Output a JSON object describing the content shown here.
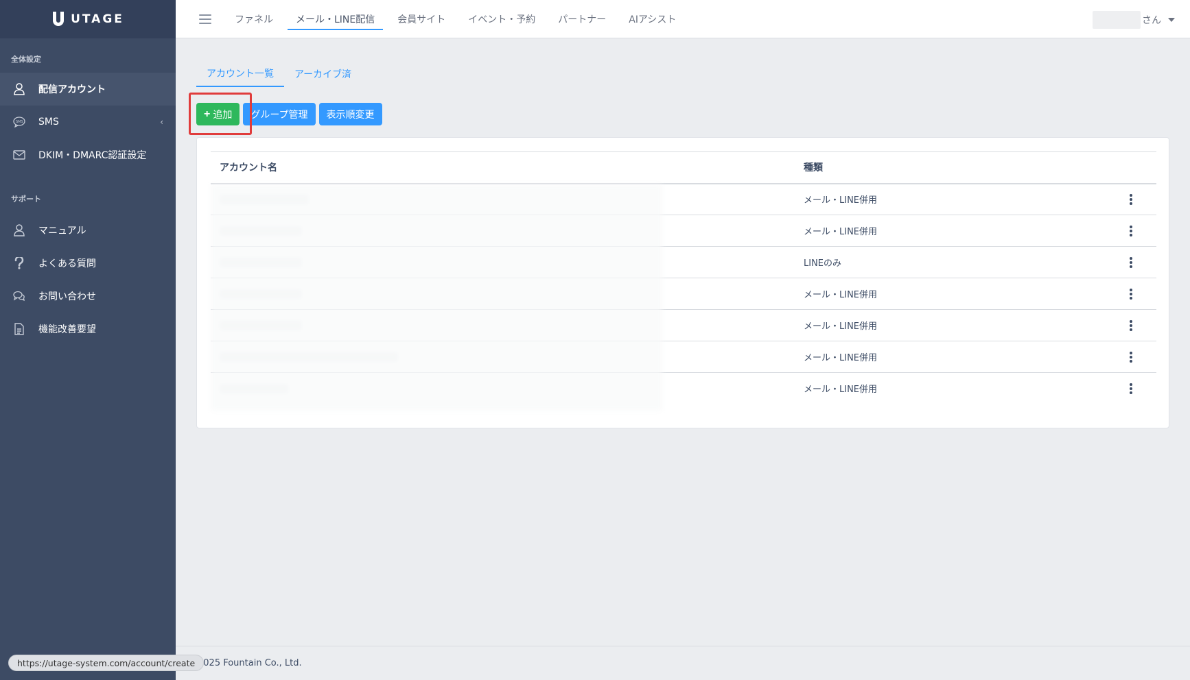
{
  "brand": {
    "name": "UTAGE"
  },
  "sidebar": {
    "section_settings": "全体設定",
    "section_support": "サポート",
    "items": [
      {
        "label": "配信アカウント",
        "icon": "user-icon"
      },
      {
        "label": "SMS",
        "icon": "sms-icon"
      },
      {
        "label": "DKIM・DMARC認証設定",
        "icon": "mail-icon"
      }
    ],
    "support_items": [
      {
        "label": "マニュアル",
        "icon": "user-icon"
      },
      {
        "label": "よくある質問",
        "icon": "question-icon"
      },
      {
        "label": "お問い合わせ",
        "icon": "chat-icon"
      },
      {
        "label": "機能改善要望",
        "icon": "document-icon"
      }
    ],
    "sms_caret": "‹"
  },
  "header": {
    "nav": [
      "ファネル",
      "メール・LINE配信",
      "会員サイト",
      "イベント・予約",
      "パートナー",
      "AIアシスト"
    ],
    "user_suffix": "さん"
  },
  "tabs": [
    "アカウント一覧",
    "アーカイブ済"
  ],
  "toolbar": {
    "add_label": "追加",
    "add_plus": "+",
    "group_label": "グループ管理",
    "order_label": "表示順変更"
  },
  "table": {
    "columns": [
      "アカウント名",
      "種類"
    ],
    "rows": [
      {
        "kind": "メール・LINE併用"
      },
      {
        "kind": "メール・LINE併用"
      },
      {
        "kind": "LINEのみ"
      },
      {
        "kind": "メール・LINE併用"
      },
      {
        "kind": "メール・LINE併用"
      },
      {
        "kind": "メール・LINE併用"
      },
      {
        "kind": "メール・LINE併用"
      }
    ]
  },
  "footer": {
    "copyright": "2025 Fountain Co., Ltd.",
    "status_url": "https://utage-system.com/account/create"
  },
  "colors": {
    "sidebar_bg": "#3d4b64",
    "accent_blue": "#3399ff",
    "success_green": "#2eb85c",
    "highlight_red": "#e03c3c"
  }
}
